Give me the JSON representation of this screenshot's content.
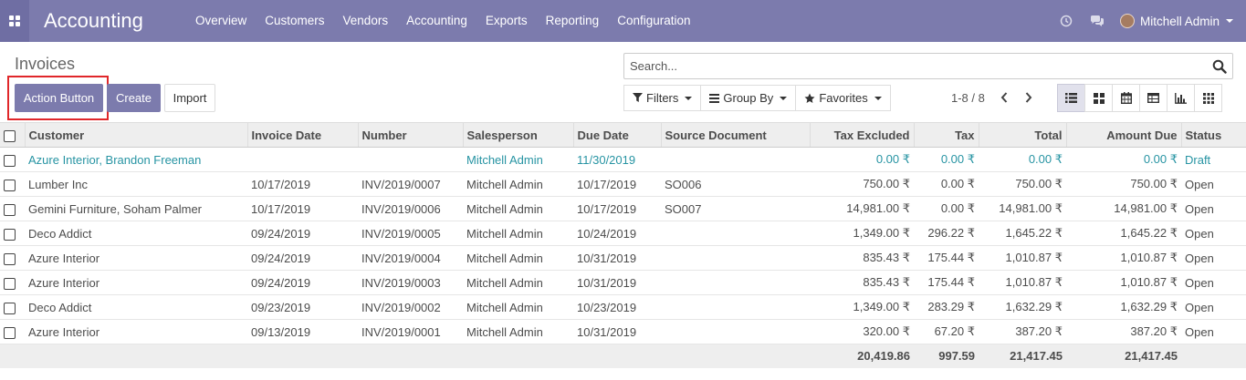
{
  "app": {
    "title": "Accounting"
  },
  "colors": {
    "navbar": "#7c7bad",
    "primary": "#7c7bad",
    "link": "#2794a3",
    "highlight": "#e0272a"
  },
  "menu": [
    "Overview",
    "Customers",
    "Vendors",
    "Accounting",
    "Exports",
    "Reporting",
    "Configuration"
  ],
  "systray": {
    "icons": [
      "clock-icon",
      "chat-icon"
    ],
    "user": "Mitchell Admin"
  },
  "page": {
    "title": "Invoices"
  },
  "buttons": {
    "action": "Action Button",
    "create": "Create",
    "import": "Import"
  },
  "search": {
    "placeholder": "Search..."
  },
  "filters": {
    "filters": "Filters",
    "group_by": "Group By",
    "favorites": "Favorites"
  },
  "pager": {
    "value": "1-8 / 8"
  },
  "views": [
    "list-view-icon",
    "kanban-view-icon",
    "calendar-view-icon",
    "pivot-view-icon",
    "graph-view-icon",
    "grid-view-icon"
  ],
  "table": {
    "columns": [
      "Customer",
      "Invoice Date",
      "Number",
      "Salesperson",
      "Due Date",
      "Source Document",
      "Tax Excluded",
      "Tax",
      "Total",
      "Amount Due",
      "Status"
    ],
    "rows": [
      [
        "Azure Interior, Brandon Freeman",
        "",
        "",
        "Mitchell Admin",
        "11/30/2019",
        "",
        "0.00 ₹",
        "0.00 ₹",
        "0.00 ₹",
        "0.00 ₹",
        "Draft"
      ],
      [
        "Lumber Inc",
        "10/17/2019",
        "INV/2019/0007",
        "Mitchell Admin",
        "10/17/2019",
        "SO006",
        "750.00 ₹",
        "0.00 ₹",
        "750.00 ₹",
        "750.00 ₹",
        "Open"
      ],
      [
        "Gemini Furniture, Soham Palmer",
        "10/17/2019",
        "INV/2019/0006",
        "Mitchell Admin",
        "10/17/2019",
        "SO007",
        "14,981.00 ₹",
        "0.00 ₹",
        "14,981.00 ₹",
        "14,981.00 ₹",
        "Open"
      ],
      [
        "Deco Addict",
        "09/24/2019",
        "INV/2019/0005",
        "Mitchell Admin",
        "10/24/2019",
        "",
        "1,349.00 ₹",
        "296.22 ₹",
        "1,645.22 ₹",
        "1,645.22 ₹",
        "Open"
      ],
      [
        "Azure Interior",
        "09/24/2019",
        "INV/2019/0004",
        "Mitchell Admin",
        "10/31/2019",
        "",
        "835.43 ₹",
        "175.44 ₹",
        "1,010.87 ₹",
        "1,010.87 ₹",
        "Open"
      ],
      [
        "Azure Interior",
        "09/24/2019",
        "INV/2019/0003",
        "Mitchell Admin",
        "10/31/2019",
        "",
        "835.43 ₹",
        "175.44 ₹",
        "1,010.87 ₹",
        "1,010.87 ₹",
        "Open"
      ],
      [
        "Deco Addict",
        "09/23/2019",
        "INV/2019/0002",
        "Mitchell Admin",
        "10/23/2019",
        "",
        "1,349.00 ₹",
        "283.29 ₹",
        "1,632.29 ₹",
        "1,632.29 ₹",
        "Open"
      ],
      [
        "Azure Interior",
        "09/13/2019",
        "INV/2019/0001",
        "Mitchell Admin",
        "10/31/2019",
        "",
        "320.00 ₹",
        "67.20 ₹",
        "387.20 ₹",
        "387.20 ₹",
        "Open"
      ]
    ],
    "totals": {
      "tax_excluded": "20,419.86",
      "tax": "997.59",
      "total": "21,417.45",
      "amount_due": "21,417.45"
    }
  }
}
